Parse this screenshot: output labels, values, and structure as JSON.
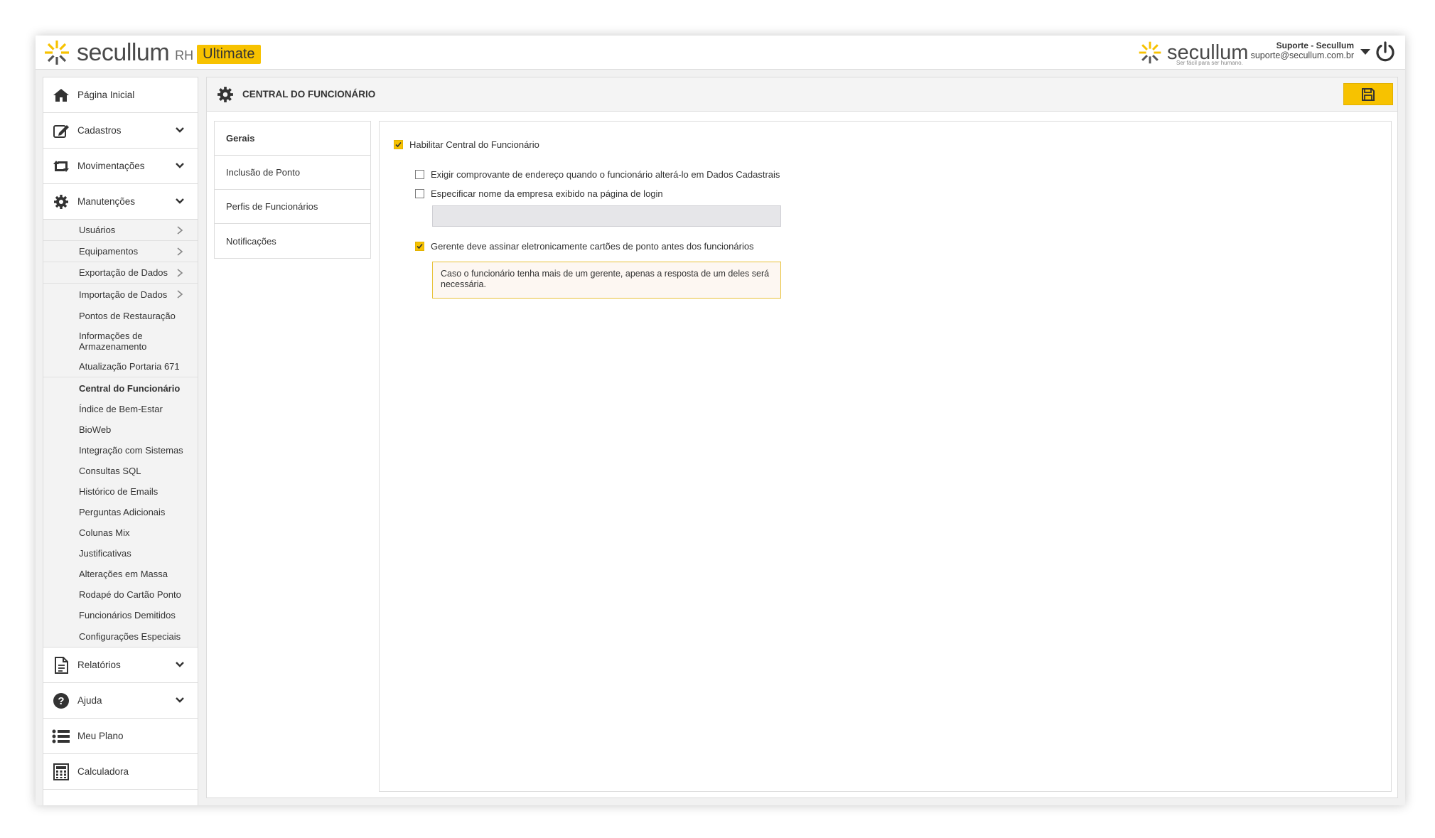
{
  "header": {
    "brand": "secullum",
    "brand_suffix": "RH",
    "edition_badge": "Ultimate",
    "right_brand": "secullum",
    "right_tagline": "Ser fácil para ser humano.",
    "user_name": "Suporte - Secullum",
    "user_email": "suporte@secullum.com.br"
  },
  "sidebar": {
    "main_top": [
      {
        "label": "Página Inicial",
        "icon": "home-icon"
      },
      {
        "label": "Cadastros",
        "icon": "edit-icon"
      },
      {
        "label": "Movimentações",
        "icon": "swap-icon"
      },
      {
        "label": "Manutenções",
        "icon": "gear-icon"
      }
    ],
    "sub_items": [
      {
        "label": "Usuários",
        "arrow": true
      },
      {
        "label": "Equipamentos",
        "arrow": true
      },
      {
        "label": "Exportação de Dados",
        "arrow": true
      },
      {
        "label": "Importação de Dados",
        "arrow": true
      },
      {
        "label": "Pontos de Restauração"
      },
      {
        "label": "Informações de Armazenamento"
      },
      {
        "label": "Atualização Portaria 671"
      },
      {
        "label": "Central do Funcionário",
        "active": true
      },
      {
        "label": "Índice de Bem-Estar"
      },
      {
        "label": "BioWeb"
      },
      {
        "label": "Integração com Sistemas"
      },
      {
        "label": "Consultas SQL"
      },
      {
        "label": "Histórico de Emails"
      },
      {
        "label": "Perguntas Adicionais"
      },
      {
        "label": "Colunas Mix"
      },
      {
        "label": "Justificativas"
      },
      {
        "label": "Alterações em Massa"
      },
      {
        "label": "Rodapé do Cartão Ponto"
      },
      {
        "label": "Funcionários Demitidos"
      },
      {
        "label": "Configurações Especiais"
      }
    ],
    "main_bottom": [
      {
        "label": "Relatórios",
        "icon": "document-icon"
      },
      {
        "label": "Ajuda",
        "icon": "help-icon"
      },
      {
        "label": "Meu Plano",
        "icon": "list-icon"
      },
      {
        "label": "Calculadora",
        "icon": "calculator-icon"
      }
    ]
  },
  "page": {
    "title": "CENTRAL DO FUNCIONÁRIO",
    "tabs": [
      "Gerais",
      "Inclusão de Ponto",
      "Perfis de Funcionários",
      "Notificações"
    ],
    "options": {
      "enable": {
        "label": "Habilitar Central do Funcionário",
        "checked": true
      },
      "proof_address": {
        "label": "Exigir comprovante de endereço quando o funcionário alterá-lo em Dados Cadastrais",
        "checked": false
      },
      "company_name": {
        "label": "Especificar nome da empresa exibido na página de login",
        "checked": false,
        "value": ""
      },
      "manager_sign": {
        "label": "Gerente deve assinar eletronicamente cartões de ponto antes dos funcionários",
        "checked": true
      }
    },
    "warning": "Caso o funcionário tenha mais de um gerente, apenas a resposta de um deles será necessária."
  },
  "colors": {
    "accent": "#f7c200",
    "warning_border": "#e8c23a",
    "warning_bg": "#fdf7f2"
  }
}
